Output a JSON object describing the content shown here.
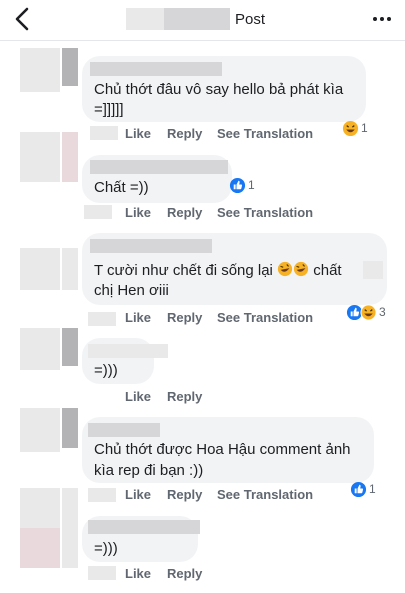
{
  "header": {
    "title": "Post",
    "back_icon": "chevron-left-icon",
    "more_icon": "more-horizontal-icon"
  },
  "labels": {
    "like": "Like",
    "reply": "Reply",
    "see_translation": "See Translation"
  },
  "colors": {
    "bubble": "#f2f3f5",
    "action_text": "#606770",
    "like_blue": "#1877f2",
    "haha_yellow": "#f7b125"
  },
  "comments": [
    {
      "text_lines": [
        "Chủ thớt đâu vô say hello bả phát kìa",
        "=]]]]]"
      ],
      "reaction_count": "1",
      "reactions": [
        "haha"
      ],
      "has_translation": true
    },
    {
      "text_lines": [
        "Chất =))"
      ],
      "reaction_count": "1",
      "reactions": [
        "like"
      ],
      "has_translation": true
    },
    {
      "text_lines": [
        "T cười như chết đi sống lại",
        "chị Hen ơiii"
      ],
      "inline_word": "chất",
      "reaction_count": "3",
      "reactions": [
        "like",
        "haha"
      ],
      "has_translation": true
    },
    {
      "text_lines": [
        "=)))"
      ],
      "reaction_count": "",
      "reactions": [],
      "has_translation": false
    },
    {
      "text_lines": [
        "Chủ thớt được Hoa Hậu comment ảnh",
        "kìa rep đi bạn :))"
      ],
      "reaction_count": "1",
      "reactions": [
        "like"
      ],
      "has_translation": true
    },
    {
      "text_lines": [
        "=)))"
      ],
      "reaction_count": "",
      "reactions": [],
      "has_translation": false
    }
  ]
}
